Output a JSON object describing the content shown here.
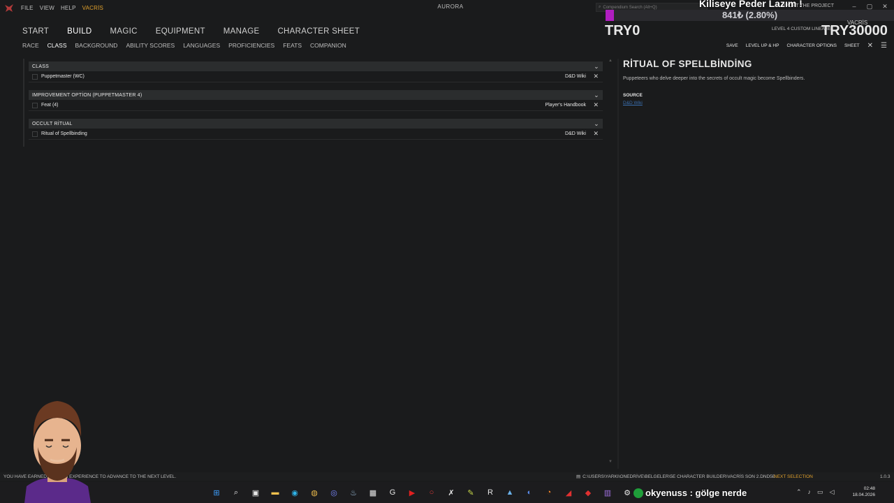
{
  "window": {
    "title": "AURORA",
    "menu": [
      "FILE",
      "VIEW",
      "HELP"
    ],
    "menu_accent": "VACRİS",
    "search_placeholder": "Compendium Search (Alt+Q)",
    "support_link": "SUPPORT THE PROJECT"
  },
  "main_nav": [
    "START",
    "BUILD",
    "MAGIC",
    "EQUIPMENT",
    "MANAGE",
    "CHARACTER SHEET"
  ],
  "main_nav_active": "BUILD",
  "sub_nav": [
    "RACE",
    "CLASS",
    "BACKGROUND",
    "ABILITY SCORES",
    "LANGUAGES",
    "PROFICIENCIES",
    "FEATS",
    "COMPANION"
  ],
  "sub_nav_active": "CLASS",
  "character": {
    "name": "VACRİS",
    "summary": "LEVEL 4 CUSTOM LINEAGE"
  },
  "right_nav": [
    "SAVE",
    "LEVEL UP & HP",
    "CHARACTER OPTIONS",
    "SHEET"
  ],
  "sections": [
    {
      "header": "CLASS",
      "item": "Puppetmaster (WC)",
      "source": "D&D Wiki"
    },
    {
      "header": "IMPROVEMENT OPTİON (PUPPETMASTER 4)",
      "item": "Feat (4)",
      "source": "Player's Handbook"
    },
    {
      "header": "OCCULT RİTUAL",
      "item": "Ritual of Spellbinding",
      "source": "D&D Wiki"
    }
  ],
  "detail": {
    "title": "RİTUAL OF SPELLBİNDİNG",
    "description": "Puppeteers who delve deeper into the secrets of occult magic become Spellbinders.",
    "source_label": "SOURCE",
    "source_link": "D&D Wiki"
  },
  "status": {
    "message": "YOU HAVE EARNED ENOUGH EXPERIENCE TO ADVANCE TO THE NEXT LEVEL.",
    "path": "C:\\USERS\\YARKI\\ONEDRİVE\\BELGELER\\5E CHARACTER BUILDER\\VACRİS SON 2.DND5E",
    "next": "NEXT SELECTION",
    "version": "1.0.3"
  },
  "overlay": {
    "goal_title": "Kiliseye Peder Lazım !",
    "goal_amount": "841₺ (2.80%)",
    "goal_fraction": 0.028,
    "goal_left": "TRY0",
    "goal_right": "TRY30000",
    "chat": "okyenuss : gölge nerde"
  },
  "clock": {
    "time": "02:48",
    "date": "18.04.2026"
  },
  "colors": {
    "accent": "#e0a02c",
    "link": "#3a6fb0",
    "goal_fill": "#b01ec0"
  }
}
